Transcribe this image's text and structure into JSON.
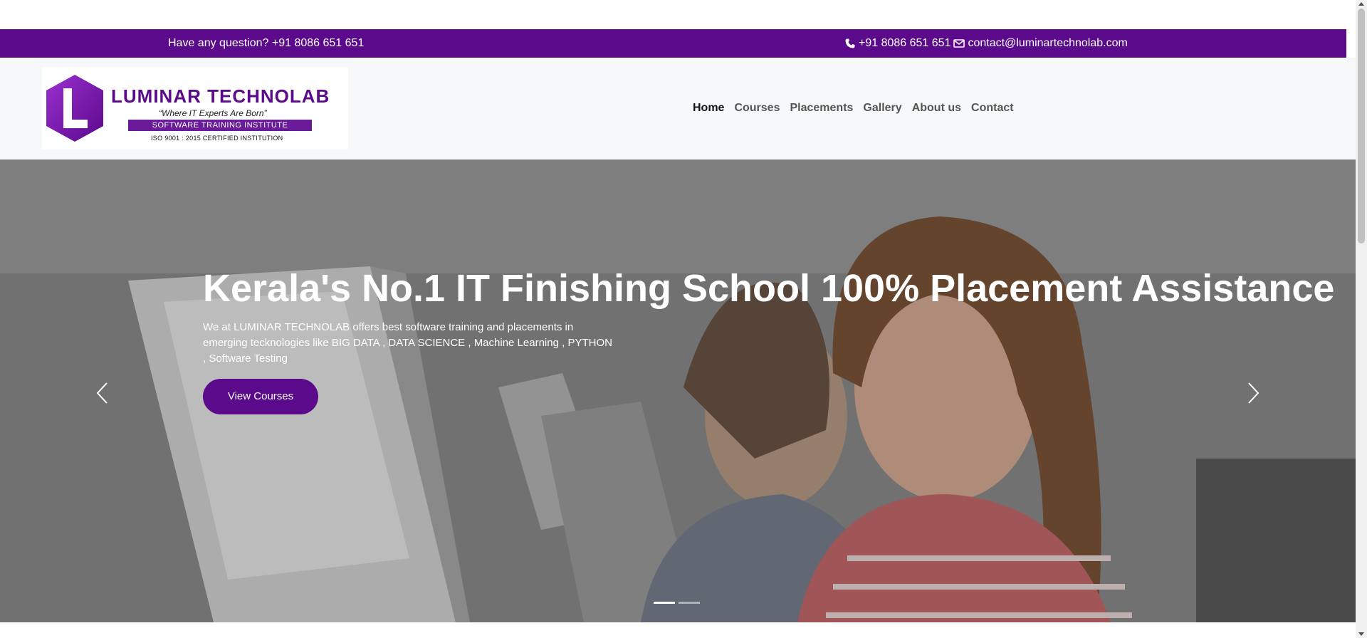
{
  "topbar": {
    "question": "Have any question? +91 8086 651 651",
    "phone": "+91 8086 651 651",
    "email": "contact@luminartechnolab.com"
  },
  "logo": {
    "brand": "LUMINAR TECHNOLAB",
    "tagline": "“Where IT Experts Are Born”",
    "subtitle": "SOFTWARE TRAINING INSTITUTE",
    "certification": "ISO 9001 : 2015 CERTIFIED INSTITUTION",
    "letter": "L"
  },
  "nav": {
    "items": [
      {
        "label": "Home",
        "active": true
      },
      {
        "label": "Courses",
        "active": false
      },
      {
        "label": "Placements",
        "active": false
      },
      {
        "label": "Gallery",
        "active": false
      },
      {
        "label": "About us",
        "active": false
      },
      {
        "label": "Contact",
        "active": false
      }
    ]
  },
  "hero": {
    "title": "Kerala's No.1 IT Finishing School 100% Placement Assistance",
    "description": "We at LUMINAR TECHNOLAB offers best software training and placements in emerging tecknologies like BIG DATA , DATA SCIENCE , Machine Learning , PYTHON , Software Testing",
    "button_label": "View Courses",
    "slides": 2,
    "active_slide": 0
  },
  "colors": {
    "brand_purple": "#5a0a8a",
    "nav_background": "#f7f8f9"
  },
  "icons": {
    "phone": "phone-icon",
    "email": "envelope-icon",
    "prev": "chevron-left-icon",
    "next": "chevron-right-icon"
  }
}
